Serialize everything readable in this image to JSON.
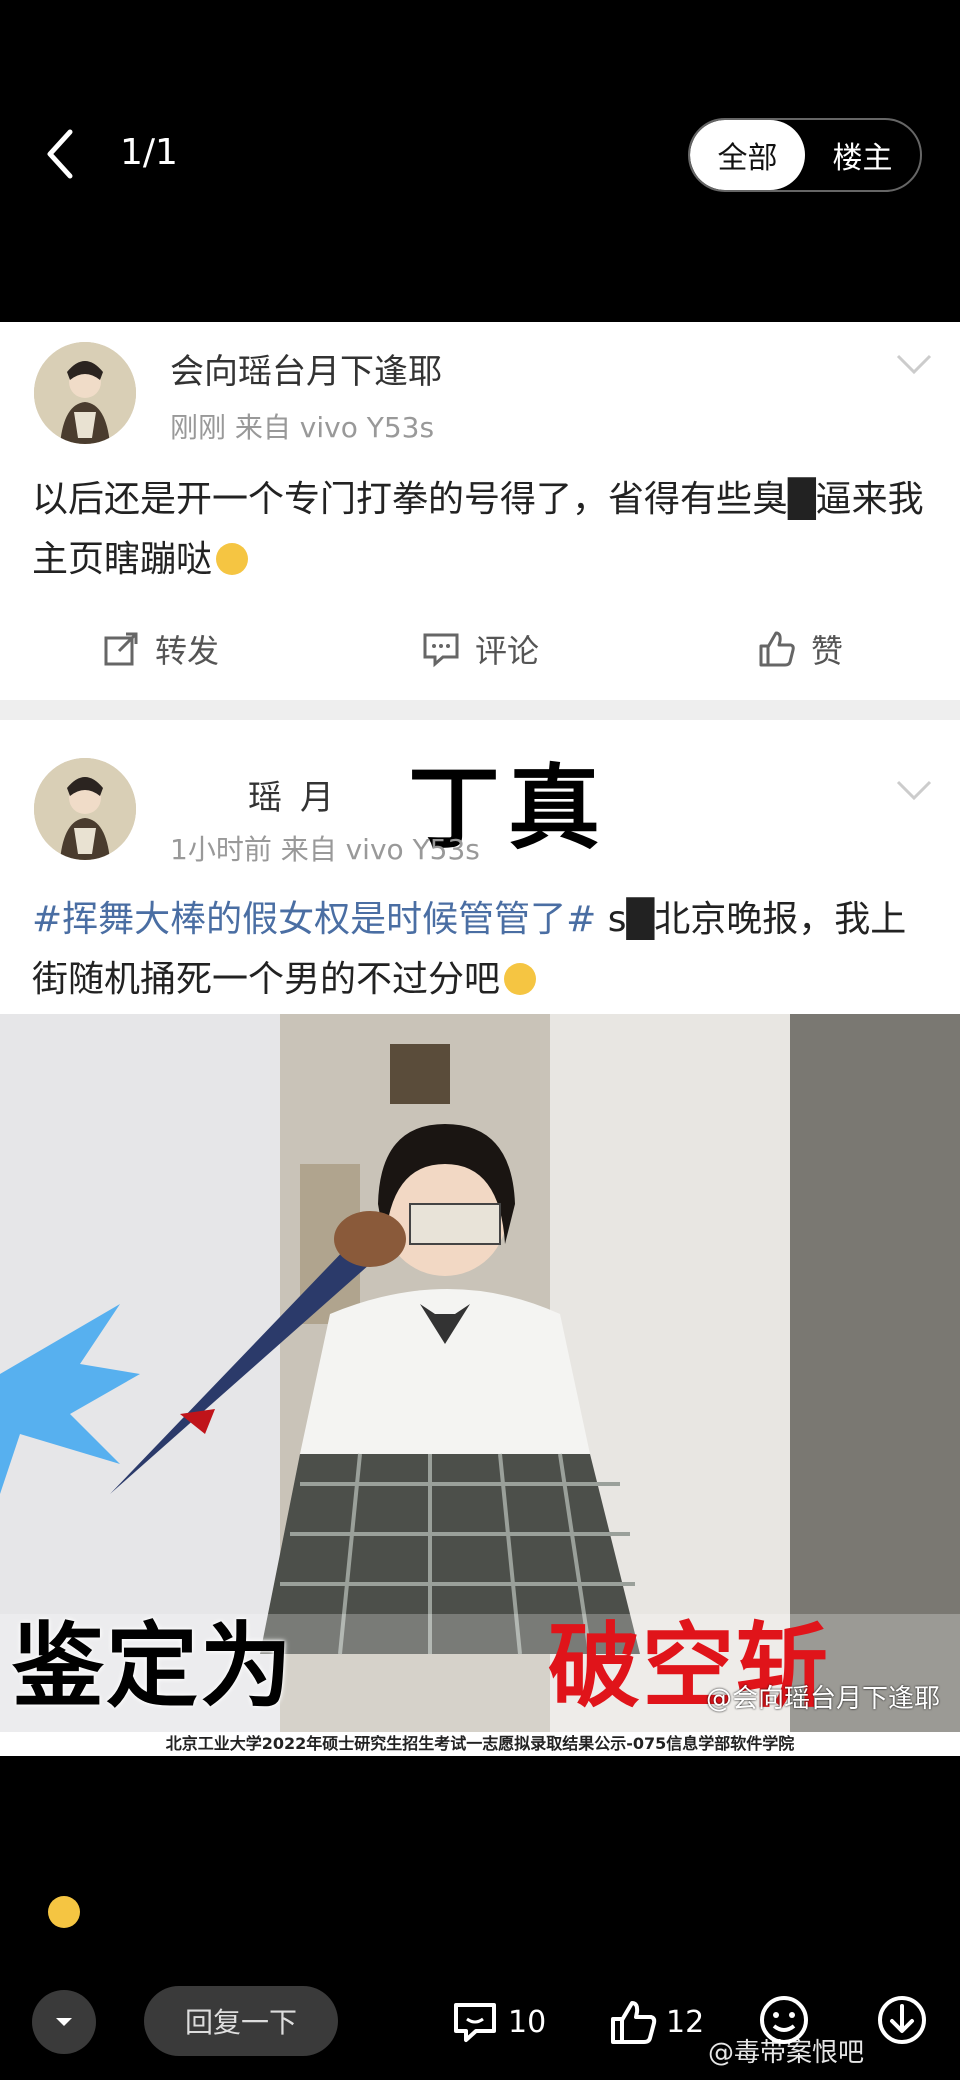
{
  "header": {
    "counter": "1/1",
    "tab_all": "全部",
    "tab_op": "楼主"
  },
  "post1": {
    "username": "会向瑶台月下逢耶",
    "meta": "刚刚   来自 vivo Y53s",
    "text": "以后还是开一个专门打拳的号得了，省得有些臭█逼来我主页瞎蹦哒",
    "actions": {
      "repost": "转发",
      "comment": "评论",
      "like": "赞"
    }
  },
  "post2": {
    "username": "瑶月",
    "overlay_name": "丁真",
    "meta": "1小时前   来自 vivo Y53s",
    "topic": "#挥舞大棒的假女权是时候管管了#",
    "text": " s█北京晚报，我上街随机捅死一个男的不过分吧",
    "caption_left": "鉴定为",
    "caption_right": "破空斩",
    "photo_watermark": "@会向瑶台月下逢耶",
    "bottom_strip": "北京工业大学2022年硕士研究生招生考试一志愿拟录取结果公示-075信息学部软件学院"
  },
  "footer": {
    "reply_placeholder": "回复一下",
    "comment_count": "10",
    "like_count": "12",
    "watermark": "@毒带案恨吧"
  },
  "colors": {
    "topic": "#4a6ea3",
    "caption_right": "#e0141a",
    "emoji": "#f5c542"
  }
}
